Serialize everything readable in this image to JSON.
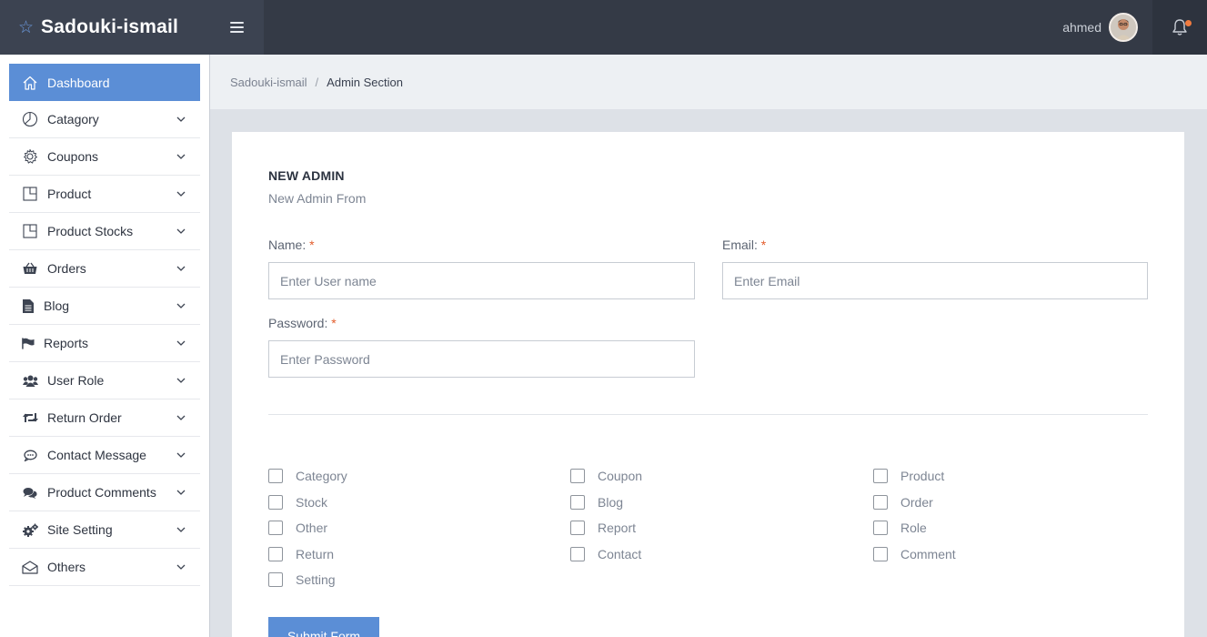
{
  "brand": {
    "name": "Sadouki-ismail",
    "icon": "star-icon"
  },
  "topbar": {
    "user_name": "ahmed",
    "notification_icon": "bell-icon",
    "notification_dot_color": "#f07b3f"
  },
  "sidebar": {
    "items": [
      {
        "label": "Dashboard",
        "icon": "home-icon",
        "active": true
      },
      {
        "label": "Catagory",
        "icon": "pie-chart-icon"
      },
      {
        "label": "Coupons",
        "icon": "gear-icon"
      },
      {
        "label": "Product",
        "icon": "layout-icon"
      },
      {
        "label": "Product Stocks",
        "icon": "layout-icon"
      },
      {
        "label": "Orders",
        "icon": "basket-icon"
      },
      {
        "label": "Blog",
        "icon": "document-icon"
      },
      {
        "label": "Reports",
        "icon": "flag-icon"
      },
      {
        "label": "User Role",
        "icon": "users-icon"
      },
      {
        "label": "Return Order",
        "icon": "retweet-icon"
      },
      {
        "label": "Contact Message",
        "icon": "comment-icon"
      },
      {
        "label": "Product Comments",
        "icon": "comments-icon"
      },
      {
        "label": "Site Setting",
        "icon": "cogs-icon"
      },
      {
        "label": "Others",
        "icon": "envelope-open-icon"
      }
    ]
  },
  "breadcrumb": {
    "root": "Sadouki-ismail",
    "separator": "/",
    "current": "Admin Section"
  },
  "form": {
    "title": "NEW ADMIN",
    "subtitle": "New Admin From",
    "required_mark": "*",
    "name": {
      "label": "Name:",
      "placeholder": "Enter User name"
    },
    "email": {
      "label": "Email:",
      "placeholder": "Enter Email"
    },
    "password": {
      "label": "Password:",
      "placeholder": "Enter Password"
    },
    "permissions": [
      [
        "Category",
        "Stock",
        "Other",
        "Return",
        "Setting"
      ],
      [
        "Coupon",
        "Blog",
        "Report",
        "Contact"
      ],
      [
        "Product",
        "Order",
        "Role",
        "Comment"
      ]
    ],
    "submit_label": "Submit Form"
  },
  "colors": {
    "accent": "#5b8ed6",
    "topbar": "#343a46",
    "required": "#e35c2b"
  }
}
